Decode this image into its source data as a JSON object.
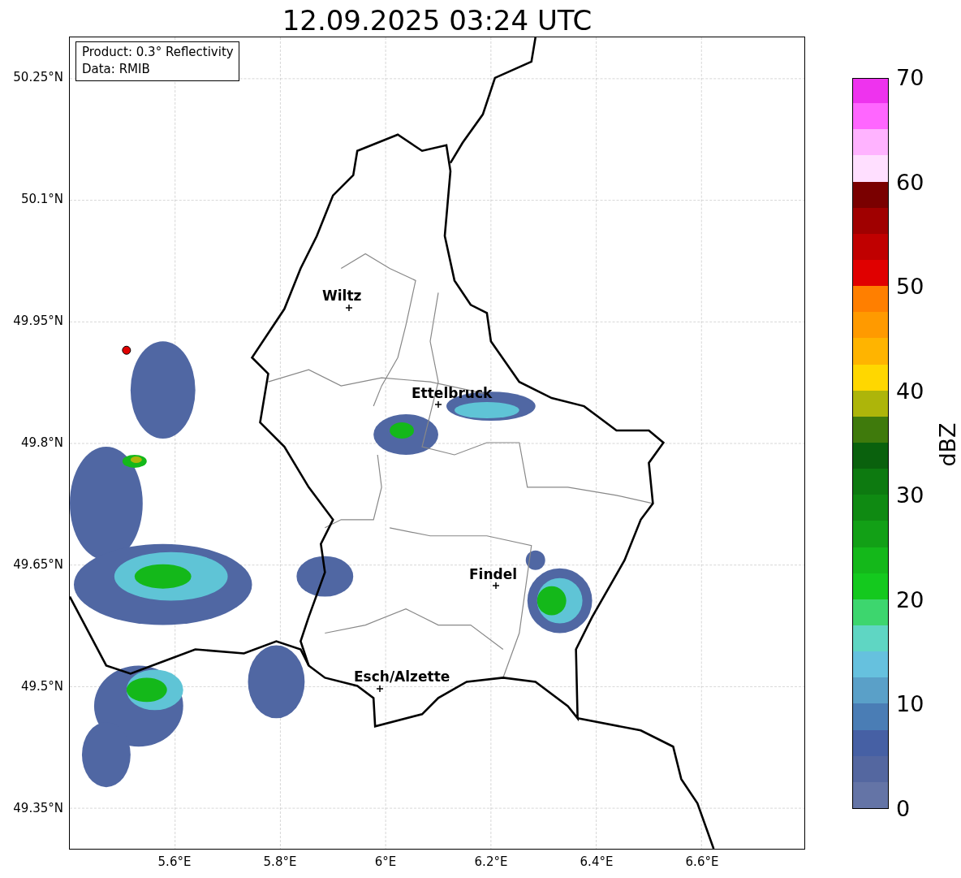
{
  "title": "12.09.2025 03:24 UTC",
  "info_box": [
    "Product: 0.3° Reflectivity",
    "Data: RMIB"
  ],
  "map": {
    "cities": [
      {
        "name": "Wiltz"
      },
      {
        "name": "Ettelbruck"
      },
      {
        "name": "Findel"
      },
      {
        "name": "Esch/Alzette"
      }
    ],
    "y_ticks": [
      "50.25°N",
      "50.1°N",
      "49.95°N",
      "49.8°N",
      "49.65°N",
      "49.5°N",
      "49.35°N"
    ],
    "x_ticks": [
      "5.6°E",
      "5.8°E",
      "6°E",
      "6.2°E",
      "6.4°E",
      "6.6°E"
    ]
  },
  "colorbar": {
    "label": "dBZ",
    "ticks": [
      "70",
      "60",
      "50",
      "40",
      "30",
      "20",
      "10",
      "0"
    ],
    "bands": [
      {
        "color": "#6474a6"
      },
      {
        "color": "#5467a0"
      },
      {
        "color": "#4660a4"
      },
      {
        "color": "#4a7db5"
      },
      {
        "color": "#5aa0c8"
      },
      {
        "color": "#66c1de"
      },
      {
        "color": "#5fd6c3"
      },
      {
        "color": "#3dd66e"
      },
      {
        "color": "#14c91e"
      },
      {
        "color": "#14b81a"
      },
      {
        "color": "#12a016"
      },
      {
        "color": "#0f8a12"
      },
      {
        "color": "#0d7a10"
      },
      {
        "color": "#0a610d"
      },
      {
        "color": "#3f7a0c"
      },
      {
        "color": "#adb50a"
      },
      {
        "color": "#ffd700"
      },
      {
        "color": "#ffb400"
      },
      {
        "color": "#ff9a00"
      },
      {
        "color": "#ff7f00"
      },
      {
        "color": "#e00000"
      },
      {
        "color": "#c00000"
      },
      {
        "color": "#a00000"
      },
      {
        "color": "#7a0000"
      },
      {
        "color": "#ffdfff"
      },
      {
        "color": "#ffb3ff"
      },
      {
        "color": "#ff66ff"
      },
      {
        "color": "#ee33ee"
      }
    ]
  }
}
